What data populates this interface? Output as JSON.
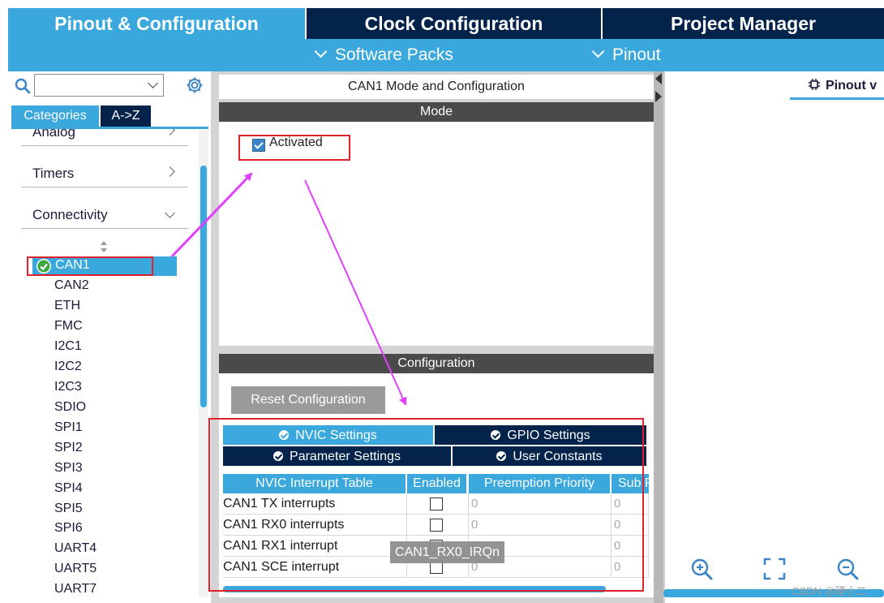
{
  "tabs": {
    "pinout": "Pinout & Configuration",
    "clock": "Clock Configuration",
    "project": "Project Manager"
  },
  "subbar": {
    "software_packs": "Software Packs",
    "pinout": "Pinout"
  },
  "sidebar": {
    "categories_tab": "Categories",
    "az_tab": "A->Z",
    "groups": {
      "analog": "Analog",
      "timers": "Timers",
      "connectivity": "Connectivity"
    },
    "peripherals": [
      "CAN1",
      "CAN2",
      "ETH",
      "FMC",
      "I2C1",
      "I2C2",
      "I2C3",
      "SDIO",
      "SPI1",
      "SPI2",
      "SPI3",
      "SPI4",
      "SPI5",
      "SPI6",
      "UART4",
      "UART5",
      "UART7"
    ],
    "selected": "CAN1"
  },
  "main": {
    "title": "CAN1 Mode and Configuration",
    "mode_header": "Mode",
    "activated_label": "Activated",
    "configuration_header": "Configuration",
    "reset_button": "Reset Configuration",
    "config_tabs": {
      "nvic": "NVIC Settings",
      "gpio": "GPIO Settings",
      "parameter": "Parameter Settings",
      "user": "User Constants"
    },
    "table": {
      "columns": [
        "NVIC Interrupt Table",
        "Enabled",
        "Preemption Priority",
        "Sub P"
      ],
      "rows": [
        {
          "name": "CAN1 TX interrupts",
          "preemption": "0",
          "sub": "0"
        },
        {
          "name": "CAN1 RX0 interrupts",
          "preemption": "0",
          "sub": "0"
        },
        {
          "name": "CAN1 RX1 interrupt",
          "preemption": "0",
          "sub": "0"
        },
        {
          "name": "CAN1 SCE interrupt",
          "preemption": "0",
          "sub": "0"
        }
      ]
    },
    "tooltip": "CAN1_RX0_IRQn"
  },
  "right": {
    "pinout_view_tab": "Pinout v"
  },
  "watermark": "CSDN @硬小二",
  "colors": {
    "accent": "#3aa8dc",
    "navy": "#03234b",
    "annotation_red": "#e0202a",
    "annotation_magenta": "#e040fb"
  }
}
